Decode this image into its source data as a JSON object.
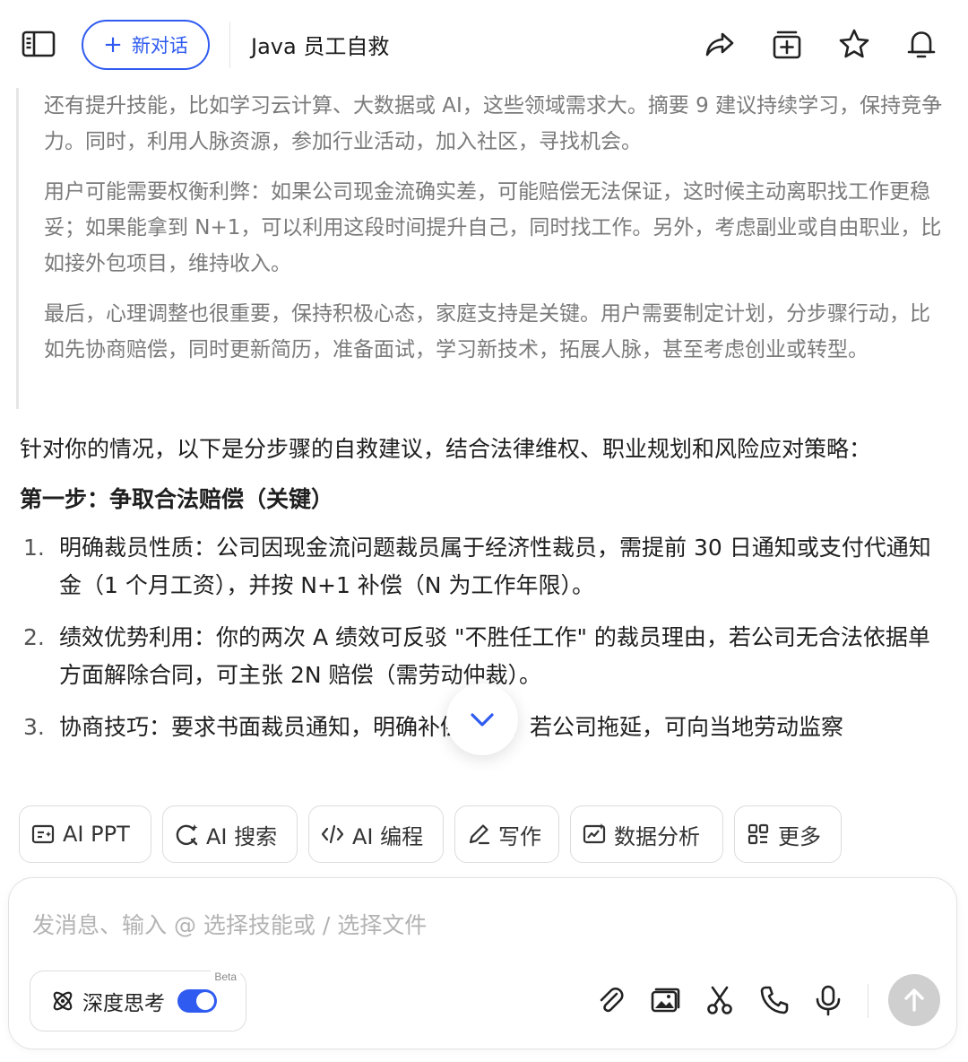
{
  "header": {
    "new_chat_label": "新对话",
    "title": "Java 员工自救"
  },
  "thinking": {
    "paragraphs": [
      "还有提升技能，比如学习云计算、大数据或 AI，这些领域需求大。摘要 9 建议持续学习，保持竞争力。同时，利用人脉资源，参加行业活动，加入社区，寻找机会。",
      "用户可能需要权衡利弊：如果公司现金流确实差，可能赔偿无法保证，这时候主动离职找工作更稳妥；如果能拿到 N+1，可以利用这段时间提升自己，同时找工作。另外，考虑副业或自由职业，比如接外包项目，维持收入。",
      "最后，心理调整也很重要，保持积极心态，家庭支持是关键。用户需要制定计划，分步骤行动，比如先协商赔偿，同时更新简历，准备面试，学习新技术，拓展人脉，甚至考虑创业或转型。"
    ]
  },
  "answer": {
    "lead": "针对你的情况，以下是分步骤的自救建议，结合法律维权、职业规划和风险应对策略：",
    "step_title": "第一步：争取合法赔偿（关键）",
    "items": [
      {
        "num": "1.",
        "text": "明确裁员性质：公司因现金流问题裁员属于经济性裁员，需提前 30 日通知或支付代通知金（1 个月工资），并按 N+1 补偿（N 为工作年限）。"
      },
      {
        "num": "2.",
        "text": "绩效优势利用：你的两次 A 绩效可反驳 \"不胜任工作\" 的裁员理由，若公司无合法依据单方面解除合同，可主张 2N 赔偿（需劳动仲裁）。"
      },
      {
        "num": "3.",
        "text": "协商技巧：要求书面裁员通知，明确补偿方案。若公司拖延，可向当地劳动监察"
      }
    ]
  },
  "skills": [
    {
      "label": "AI PPT",
      "icon": "ppt-icon"
    },
    {
      "label": "AI 搜索",
      "icon": "ai-search-icon"
    },
    {
      "label": "AI 编程",
      "icon": "code-icon"
    },
    {
      "label": "写作",
      "icon": "pen-icon"
    },
    {
      "label": "数据分析",
      "icon": "chart-icon"
    },
    {
      "label": "更多",
      "icon": "grid-icon"
    }
  ],
  "composer": {
    "placeholder": "发消息、输入 @ 选择技能或 / 选择文件",
    "deep_think_label": "深度思考",
    "beta_label": "Beta"
  },
  "colors": {
    "accent": "#2f5bf0",
    "send_disabled": "#cfcfcf"
  }
}
